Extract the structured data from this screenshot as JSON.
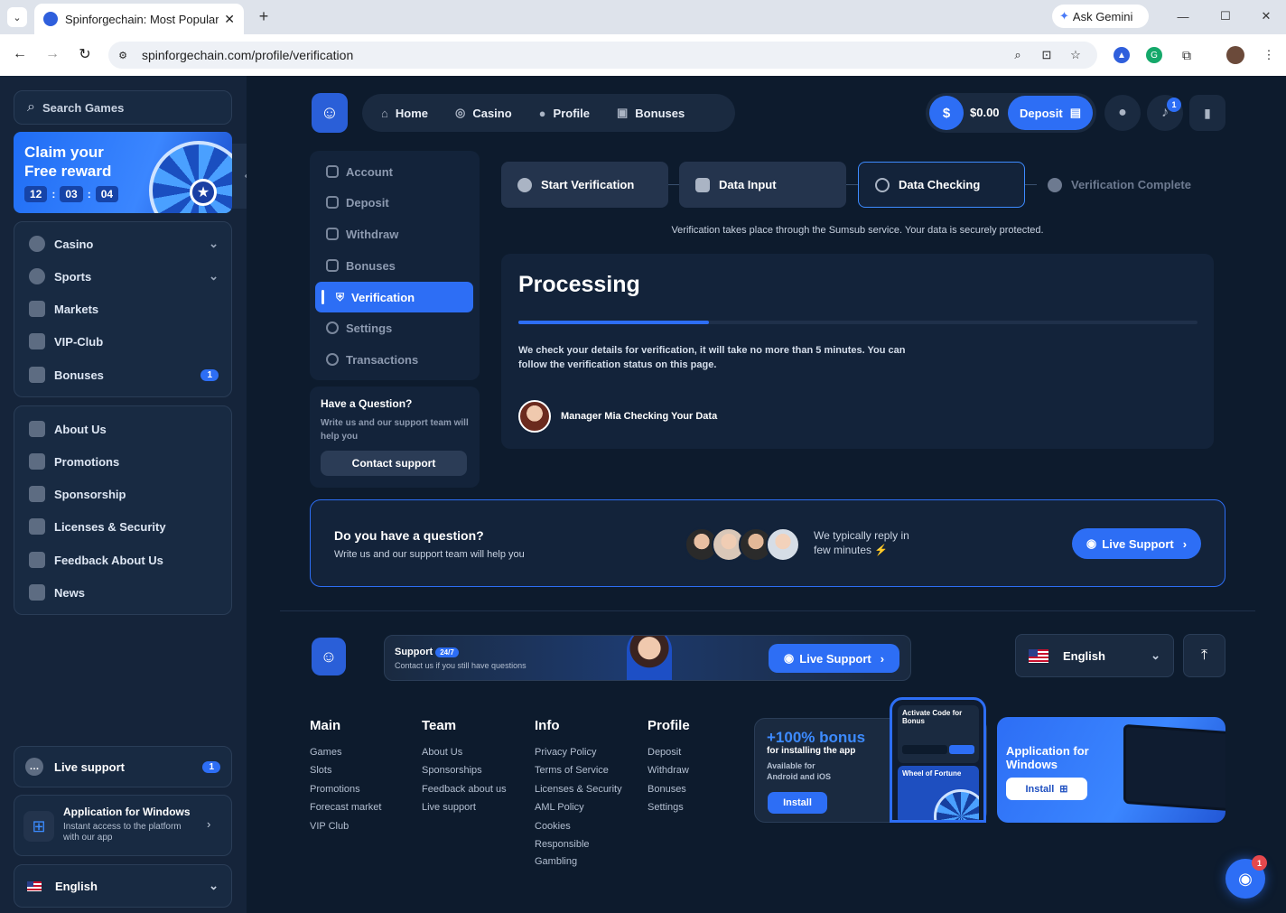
{
  "browser": {
    "tab_title": "Spinforgechain: Most Popular C",
    "url": "spinforgechain.com/profile/verification",
    "ask_gemini": "Ask Gemini",
    "ext_badge": "1"
  },
  "sidebar": {
    "search_placeholder": "Search Games",
    "promo": {
      "line1": "Claim your",
      "line2": "Free reward",
      "h": "12",
      "m": "03",
      "s": "04"
    },
    "group1": [
      {
        "label": "Casino"
      },
      {
        "label": "Sports"
      },
      {
        "label": "Markets"
      },
      {
        "label": "VIP-Club"
      },
      {
        "label": "Bonuses",
        "badge": "1"
      }
    ],
    "group2": [
      {
        "label": "About Us"
      },
      {
        "label": "Promotions"
      },
      {
        "label": "Sponsorship"
      },
      {
        "label": "Licenses & Security"
      },
      {
        "label": "Feedback About Us"
      },
      {
        "label": "News"
      }
    ],
    "live_support": {
      "label": "Live support",
      "badge": "1"
    },
    "app": {
      "title": "Application for Windows",
      "subtitle": "Instant access to the platform with our app"
    },
    "language": "English"
  },
  "header": {
    "nav": [
      "Home",
      "Casino",
      "Profile",
      "Bonuses"
    ],
    "balance": "$0.00",
    "deposit": "Deposit",
    "notif_badge": "1"
  },
  "profile_menu": {
    "items": [
      "Account",
      "Deposit",
      "Withdraw",
      "Bonuses",
      "Verification",
      "Settings",
      "Transactions"
    ],
    "active_index": 4,
    "question": {
      "title": "Have a Question?",
      "text": "Write us and our support team will help you",
      "button": "Contact support"
    }
  },
  "verification": {
    "steps": [
      "Start Verification",
      "Data Input",
      "Data Checking",
      "Verification Complete"
    ],
    "active_step": 2,
    "notice": "Verification takes place through the Sumsub service. Your data is securely protected.",
    "title": "Processing",
    "progress": 0.28,
    "description": "We check your details for verification, it will take no more than 5 minutes. You can follow the verification status on this page.",
    "manager": "Manager Mia Checking Your Data"
  },
  "support_banner": {
    "title": "Do you have a question?",
    "text": "Write us and our support team will help you",
    "reply": "We typically reply in few minutes",
    "button": "Live Support"
  },
  "footer": {
    "support_bar": {
      "title": "Support",
      "badge": "24/7",
      "text": "Contact us if you still have questions",
      "button": "Live Support"
    },
    "language": "English",
    "columns": [
      {
        "title": "Main",
        "links": [
          "Games",
          "Slots",
          "Promotions",
          "Forecast market",
          "VIP Club"
        ]
      },
      {
        "title": "Team",
        "links": [
          "About Us",
          "Sponsorships",
          "Feedback about us",
          "Live support"
        ]
      },
      {
        "title": "Info",
        "links": [
          "Privacy Policy",
          "Terms of Service",
          "Licenses & Security",
          "AML Policy",
          "Cookies",
          "Responsible",
          "Gambling"
        ]
      },
      {
        "title": "Profile",
        "links": [
          "Deposit",
          "Withdraw",
          "Bonuses",
          "Settings"
        ]
      }
    ],
    "app_card": {
      "bonus": "+100% bonus",
      "bonus_sub": "for installing the app",
      "avail": "Available for Android and iOS",
      "button": "Install",
      "phone_code": "Activate Code for Bonus",
      "phone_wheel": "Wheel of Fortune"
    },
    "win_card": {
      "title": "Application for Windows",
      "button": "Install"
    },
    "chat_badge": "1"
  }
}
